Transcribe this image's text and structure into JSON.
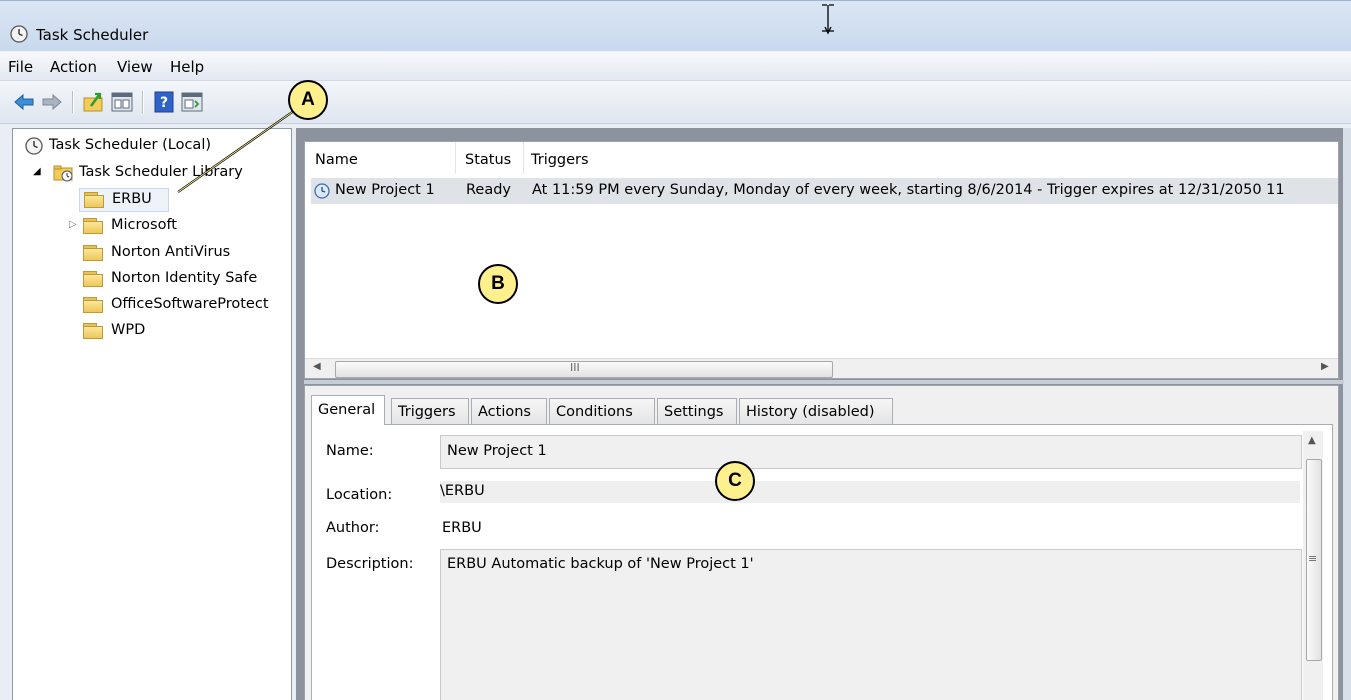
{
  "window": {
    "title": "Task Scheduler"
  },
  "menu": [
    "File",
    "Action",
    "View",
    "Help"
  ],
  "toolbar": {
    "icons": [
      "back-arrow-icon",
      "forward-arrow-icon",
      "folder-up-icon",
      "show-console-tree-icon",
      "help-icon",
      "show-action-pane-icon"
    ]
  },
  "tree": {
    "root": "Task Scheduler (Local)",
    "library": "Task Scheduler Library",
    "folders": [
      "ERBU",
      "Microsoft",
      "Norton AntiVirus",
      "Norton Identity Safe",
      "OfficeSoftwareProtect",
      "WPD"
    ],
    "selected": "ERBU"
  },
  "task_list": {
    "columns": [
      "Name",
      "Status",
      "Triggers"
    ],
    "rows": [
      {
        "name": "New Project 1",
        "status": "Ready",
        "triggers": "At 11:59 PM every Sunday, Monday of every week, starting 8/6/2014 - Trigger expires at 12/31/2050 11"
      }
    ],
    "scroll_mark": "III"
  },
  "details": {
    "tabs": [
      "General",
      "Triggers",
      "Actions",
      "Conditions",
      "Settings",
      "History (disabled)"
    ],
    "active_tab": "General",
    "labels": {
      "name": "Name:",
      "location": "Location:",
      "author": "Author:",
      "description": "Description:"
    },
    "values": {
      "name": "New Project 1",
      "location": "\\ERBU",
      "author": "ERBU",
      "description": "ERBU Automatic backup of 'New Project 1'"
    },
    "scroll_mark": "≡"
  },
  "callouts": [
    "A",
    "B",
    "C"
  ],
  "colors": {
    "callout_fill": "#fef08d",
    "title_bar": "#d3e0f1",
    "selected_row": "#dfe3e8"
  }
}
